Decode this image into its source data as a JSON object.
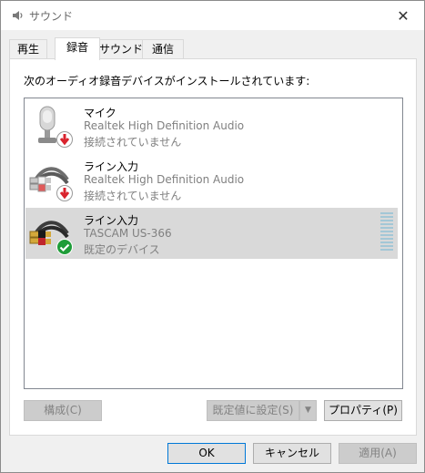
{
  "window": {
    "title": "サウンド",
    "close_glyph": "✕"
  },
  "tabs": [
    {
      "label": "再生"
    },
    {
      "label": "録音"
    },
    {
      "label": "サウンド"
    },
    {
      "label": "通信"
    }
  ],
  "description": "次のオーディオ録音デバイスがインストールされています:",
  "devices": [
    {
      "name": "マイク",
      "driver": "Realtek High Definition Audio",
      "status": "接続されていません",
      "icon": "microphone-icon",
      "badge": "disconnected-badge"
    },
    {
      "name": "ライン入力",
      "driver": "Realtek High Definition Audio",
      "status": "接続されていません",
      "icon": "line-in-cable-icon",
      "badge": "disconnected-badge"
    },
    {
      "name": "ライン入力",
      "driver": "TASCAM US-366",
      "status": "既定のデバイス",
      "icon": "line-in-cable-icon",
      "badge": "default-device-badge",
      "selected": true,
      "level": 0
    }
  ],
  "buttons": {
    "configure": "構成(C)",
    "set_default": "既定値に設定(S)",
    "set_default_arrow": "▼",
    "properties": "プロパティ(P)",
    "ok": "OK",
    "cancel": "キャンセル",
    "apply": "適用(A)"
  },
  "colors": {
    "badge_down": "#d9232d",
    "badge_ok": "#1f9d39",
    "meter": "#a3c7d6"
  }
}
